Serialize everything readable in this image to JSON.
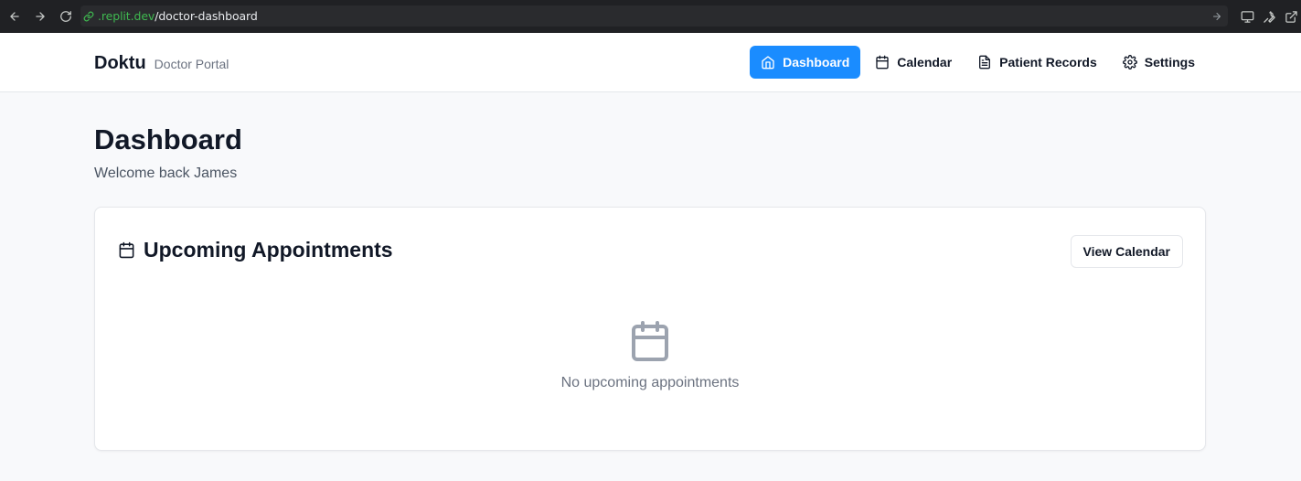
{
  "browser": {
    "url_host": ".replit.dev",
    "url_path": "/doctor-dashboard"
  },
  "header": {
    "brand": "Doktu",
    "subtitle": "Doctor Portal",
    "nav": [
      {
        "label": "Dashboard",
        "icon": "home-icon",
        "active": true
      },
      {
        "label": "Calendar",
        "icon": "calendar-icon",
        "active": false
      },
      {
        "label": "Patient Records",
        "icon": "document-icon",
        "active": false
      },
      {
        "label": "Settings",
        "icon": "gear-icon",
        "active": false
      }
    ]
  },
  "main": {
    "title": "Dashboard",
    "welcome": "Welcome back James",
    "appointments": {
      "title": "Upcoming Appointments",
      "button": "View Calendar",
      "empty_text": "No upcoming appointments"
    }
  },
  "colors": {
    "accent": "#1a8cff",
    "background": "#f8f9fb"
  }
}
